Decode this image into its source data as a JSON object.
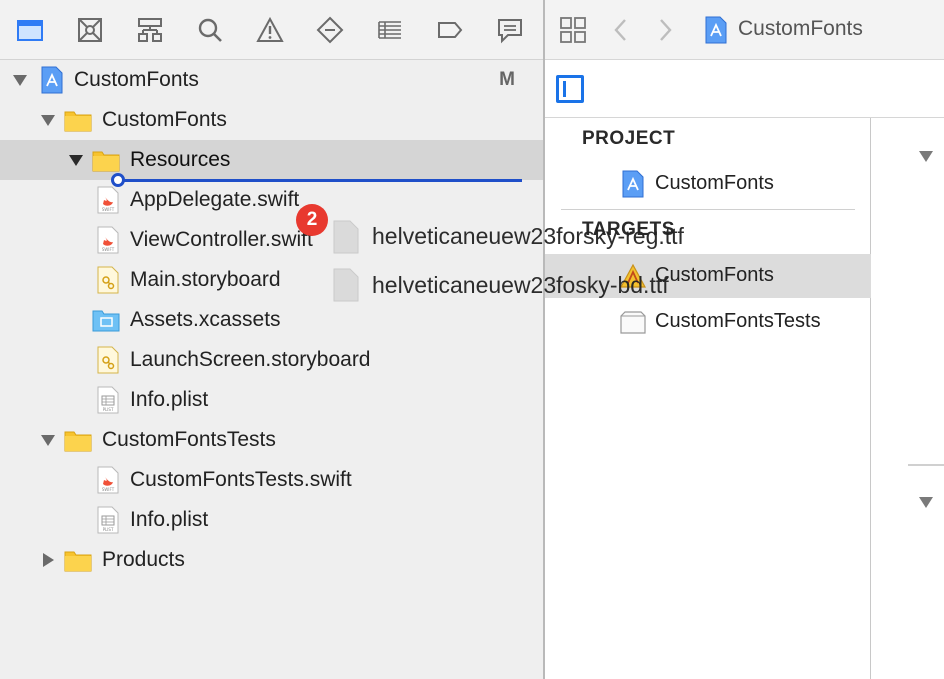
{
  "navigator": {
    "toolbar_icons": [
      "project-navigator-icon",
      "source-control-icon",
      "symbol-navigator-icon",
      "find-icon",
      "issue-icon",
      "test-icon",
      "debug-icon",
      "breakpoint-icon",
      "report-icon"
    ],
    "tree": {
      "project": {
        "label": "CustomFonts",
        "badge": "M"
      },
      "group_main": {
        "label": "CustomFonts"
      },
      "resources": {
        "label": "Resources"
      },
      "files": [
        {
          "label": "AppDelegate.swift",
          "type": "swift"
        },
        {
          "label": "ViewController.swift",
          "type": "swift"
        },
        {
          "label": "Main.storyboard",
          "type": "storyboard"
        },
        {
          "label": "Assets.xcassets",
          "type": "xcassets"
        },
        {
          "label": "LaunchScreen.storyboard",
          "type": "storyboard"
        },
        {
          "label": "Info.plist",
          "type": "plist"
        }
      ],
      "group_tests": {
        "label": "CustomFontsTests"
      },
      "test_files": [
        {
          "label": "CustomFontsTests.swift",
          "type": "swift"
        },
        {
          "label": "Info.plist",
          "type": "plist"
        }
      ],
      "products": {
        "label": "Products"
      }
    }
  },
  "drag": {
    "count": "2",
    "files": [
      "helveticaneuew23forsky-reg.ttf",
      "helveticaneuew23fosky-bd.ttf"
    ]
  },
  "editor": {
    "jumpbar_title": "CustomFonts",
    "outline": {
      "project_header": "PROJECT",
      "project_item": "CustomFonts",
      "targets_header": "TARGETS",
      "targets": [
        "CustomFonts",
        "CustomFontsTests"
      ]
    }
  },
  "colors": {
    "accent": "#1a73e8",
    "drop_indicator": "#1f4fc9",
    "badge": "#e8392f",
    "folder": "#f7c32e"
  }
}
